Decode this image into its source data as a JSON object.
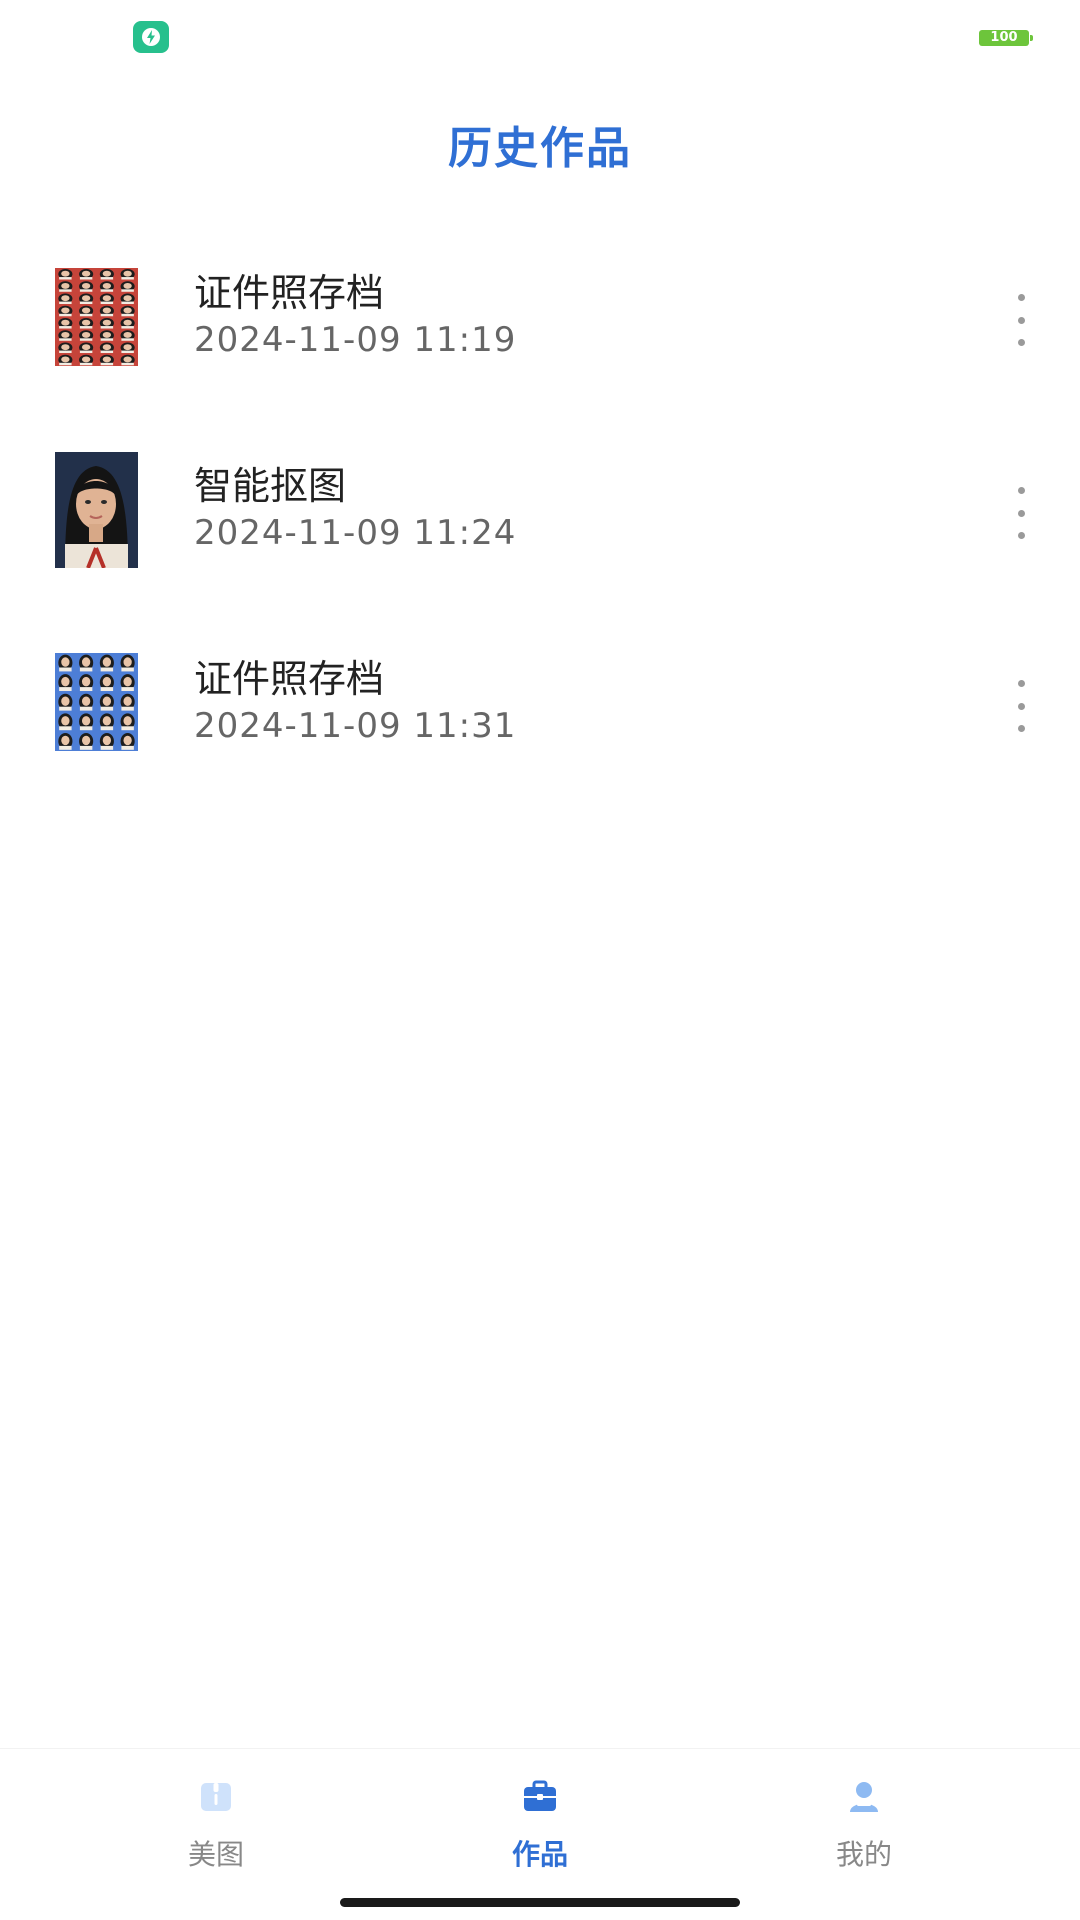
{
  "status_bar": {
    "app_icon": "shield-lightning-icon",
    "battery_level": "100",
    "battery_color": "#6dc53b",
    "app_icon_color": "#27c08d"
  },
  "header": {
    "title": "历史作品",
    "title_color": "#2f6fd4"
  },
  "history": {
    "items": [
      {
        "title": "证件照存档",
        "date": "2024-11-09 11:19",
        "thumbnail": "red-background-photo-sheet",
        "more_icon": "more-vertical-icon"
      },
      {
        "title": "智能抠图",
        "date": "2024-11-09 11:24",
        "thumbnail": "portrait-dark-background",
        "more_icon": "more-vertical-icon"
      },
      {
        "title": "证件照存档",
        "date": "2024-11-09 11:31",
        "thumbnail": "blue-background-photo-sheet",
        "more_icon": "more-vertical-icon"
      }
    ]
  },
  "tab_bar": {
    "tabs": [
      {
        "label": "美图",
        "icon": "image-card-icon",
        "active": false
      },
      {
        "label": "作品",
        "icon": "briefcase-icon",
        "active": true
      },
      {
        "label": "我的",
        "icon": "user-icon",
        "active": false
      }
    ],
    "active_color": "#2f6fd4"
  }
}
